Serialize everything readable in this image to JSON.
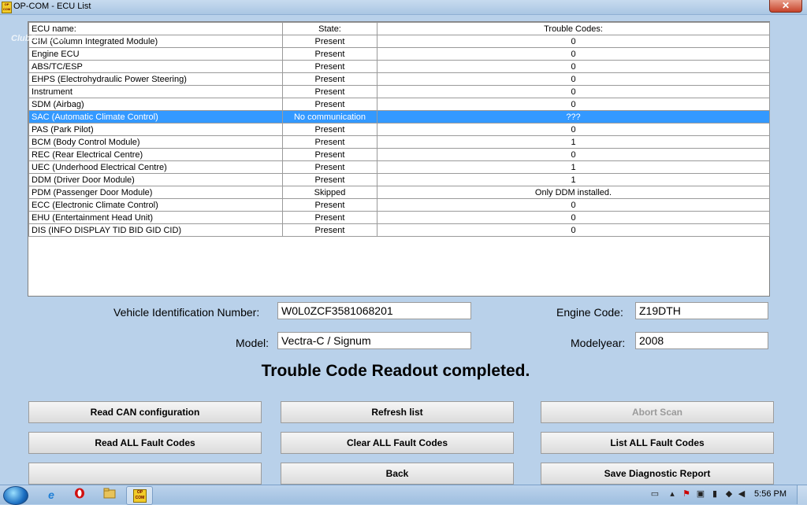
{
  "window": {
    "title": "OP-COM - ECU List",
    "close_label": "✕",
    "app_icon_text": "OP COM"
  },
  "watermark": "ClubBus.com",
  "table": {
    "headers": [
      "ECU name:",
      "State:",
      "Trouble Codes:"
    ],
    "rows": [
      [
        "CIM (Column Integrated Module)",
        "Present",
        "0"
      ],
      [
        "Engine ECU",
        "Present",
        "0"
      ],
      [
        "ABS/TC/ESP",
        "Present",
        "0"
      ],
      [
        "EHPS (Electrohydraulic Power Steering)",
        "Present",
        "0"
      ],
      [
        "Instrument",
        "Present",
        "0"
      ],
      [
        "SDM (Airbag)",
        "Present",
        "0"
      ],
      [
        "SAC (Automatic Climate Control)",
        "No communication",
        "???"
      ],
      [
        "PAS (Park Pilot)",
        "Present",
        "0"
      ],
      [
        "BCM (Body Control Module)",
        "Present",
        "1"
      ],
      [
        "REC (Rear Electrical Centre)",
        "Present",
        "0"
      ],
      [
        "UEC (Underhood Electrical Centre)",
        "Present",
        "1"
      ],
      [
        "DDM (Driver Door Module)",
        "Present",
        "1"
      ],
      [
        "PDM (Passenger Door Module)",
        "Skipped",
        "Only DDM installed."
      ],
      [
        "ECC (Electronic Climate Control)",
        "Present",
        "0"
      ],
      [
        "EHU (Entertainment Head Unit)",
        "Present",
        "0"
      ],
      [
        "DIS (INFO DISPLAY TID  BID  GID CID)",
        "Present",
        "0"
      ]
    ],
    "selected_row": 6
  },
  "vehicle": {
    "vin_label": "Vehicle Identification Number:",
    "vin_value": "W0L0ZCF3581068201",
    "engine_label": "Engine Code:",
    "engine_value": "Z19DTH",
    "model_label": "Model:",
    "model_value": "Vectra-C / Signum",
    "modelyear_label": "Modelyear:",
    "modelyear_value": "2008"
  },
  "status_text": "Trouble Code Readout completed.",
  "buttons": {
    "read_can": "Read CAN configuration",
    "refresh": "Refresh list",
    "abort_scan": "Abort Scan",
    "read_all": "Read ALL Fault Codes",
    "clear_all": "Clear ALL Fault Codes",
    "list_all": "List ALL Fault Codes",
    "empty": "",
    "back": "Back",
    "save_report": "Save Diagnostic Report"
  },
  "taskbar": {
    "clock": "5:56 PM",
    "icons": [
      "start-orb",
      "internet-explorer-icon",
      "opera-icon",
      "file-explorer-icon",
      "opcom-icon"
    ]
  }
}
